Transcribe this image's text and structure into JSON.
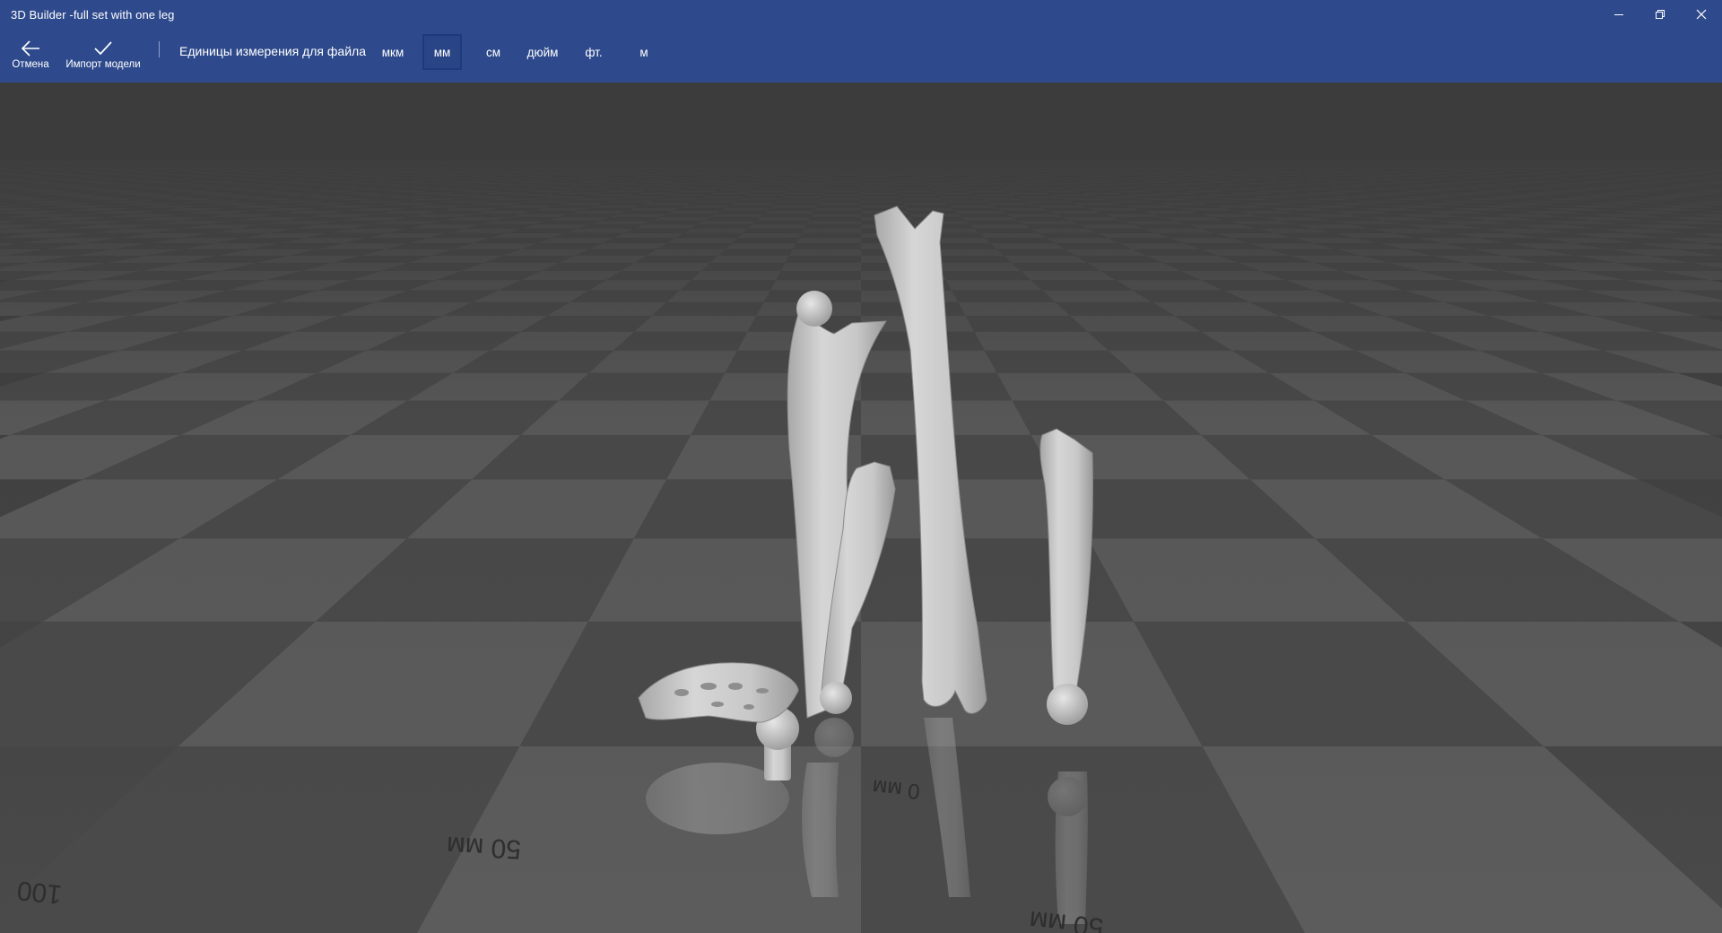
{
  "window": {
    "title": "3D Builder -full set with one leg",
    "minimize_icon": "minimize-icon",
    "restore_icon": "restore-icon",
    "close_icon": "close-icon"
  },
  "toolbar": {
    "cancel": {
      "label": "Отмена",
      "icon": "back-arrow-icon"
    },
    "import": {
      "label": "Импорт модели",
      "icon": "checkmark-icon"
    },
    "units_label": "Единицы измерения для файла",
    "units": [
      "мкм",
      "мм",
      "см",
      "дюйм",
      "фт.",
      "м"
    ],
    "selected_unit": "мм"
  },
  "viewport": {
    "ruler_labels": [
      "50 мм",
      "100",
      "0 мм",
      "50 мм"
    ],
    "floor_colors": {
      "light": "#5c5c5c",
      "dark": "#4a4a4a"
    },
    "model_color": "#d0d0d0"
  }
}
